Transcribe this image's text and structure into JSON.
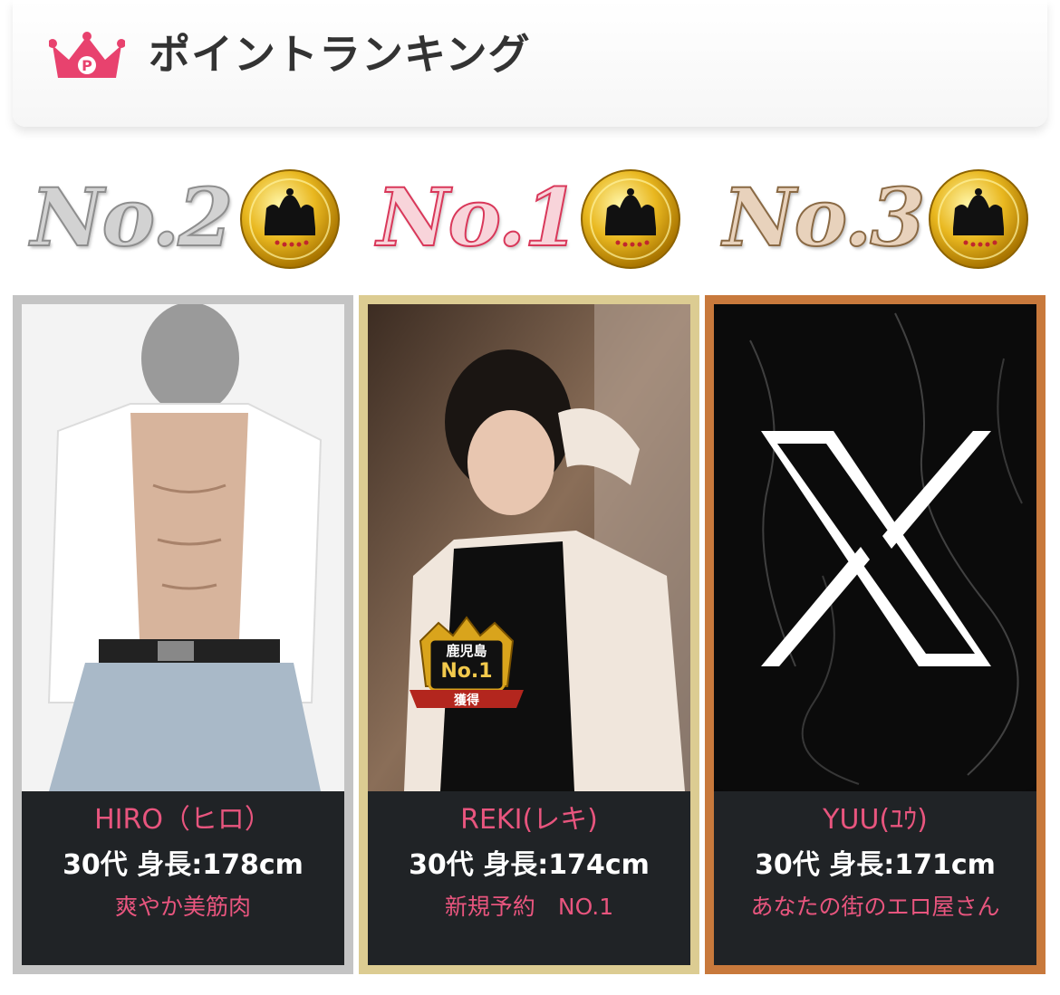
{
  "header": {
    "title": "ポイントランキング",
    "icon": "crown-p-icon",
    "icon_letter": "P",
    "accent": "#e8426e"
  },
  "ranks": [
    {
      "label": "No.2",
      "style": "silver"
    },
    {
      "label": "No.1",
      "style": "pink"
    },
    {
      "label": "No.3",
      "style": "bronze"
    }
  ],
  "cards": [
    {
      "rank": 2,
      "frame_color": "#c4c4c4",
      "name": "HIRO（ヒロ）",
      "spec": "30代 身長:178cm",
      "catch": "爽やか美筋肉"
    },
    {
      "rank": 1,
      "frame_color": "#dccc92",
      "name": "REKI(レキ)",
      "spec": "30代 身長:174cm",
      "catch": "新規予約　NO.1",
      "badge": {
        "line1": "鹿児島",
        "line2": "No.1",
        "line3": "獲得"
      }
    },
    {
      "rank": 3,
      "frame_color": "#c8793c",
      "name": "YUU(ﾕｳ)",
      "spec": "30代 身長:171cm",
      "catch": "あなたの街のエロ屋さん",
      "photo_icon": "x-logo-icon"
    }
  ]
}
